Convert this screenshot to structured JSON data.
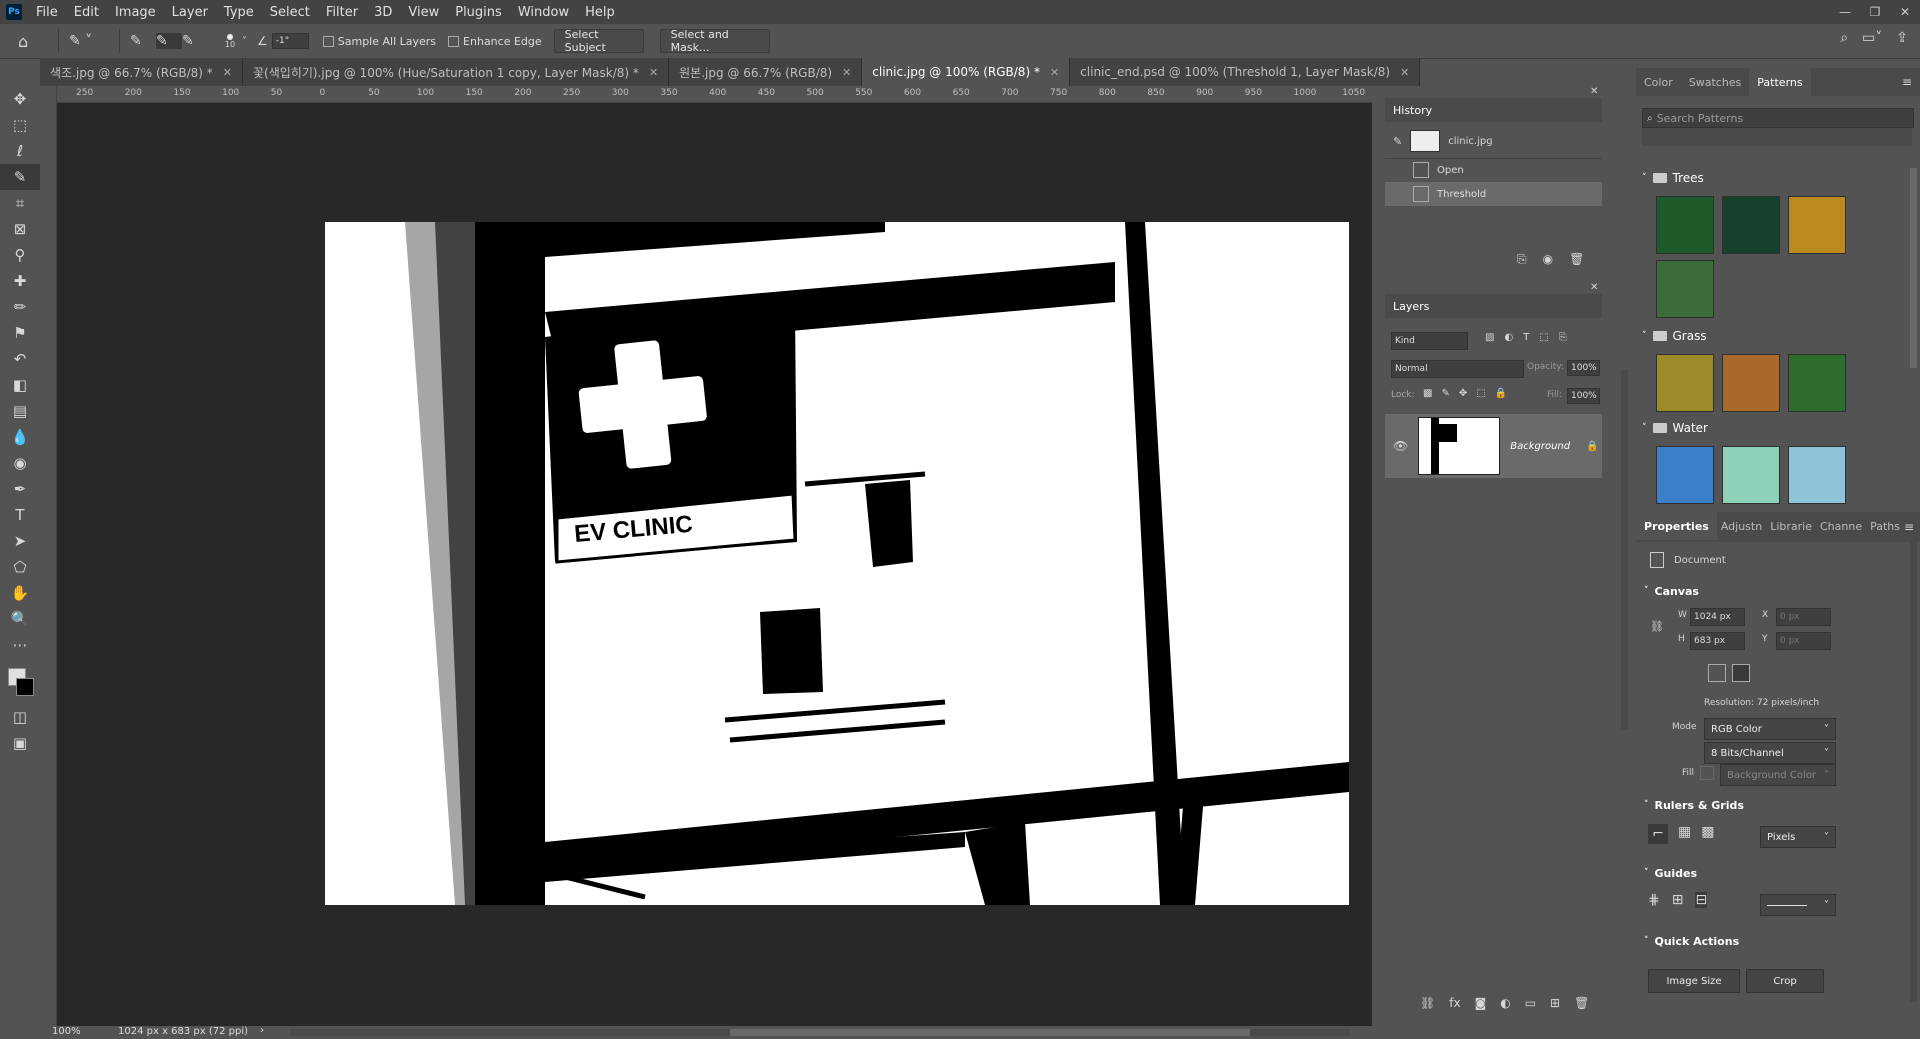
{
  "app": {
    "logo": "Ps"
  },
  "menu": [
    "File",
    "Edit",
    "Image",
    "Layer",
    "Type",
    "Select",
    "Filter",
    "3D",
    "View",
    "Plugins",
    "Window",
    "Help"
  ],
  "options": {
    "brush_size": "10",
    "angle": "-1°",
    "sample_all_layers": "Sample All Layers",
    "enhance_edge": "Enhance Edge",
    "select_subject": "Select Subject",
    "select_and_mask": "Select and Mask..."
  },
  "tabs": [
    {
      "label": "색조.jpg @ 66.7% (RGB/8) *",
      "active": false
    },
    {
      "label": "꽃(색입히기).jpg @ 100% (Hue/Saturation 1 copy, Layer Mask/8) *",
      "active": false
    },
    {
      "label": "원본.jpg @ 66.7% (RGB/8)",
      "active": false
    },
    {
      "label": "clinic.jpg @ 100% (RGB/8) *",
      "active": true
    },
    {
      "label": "clinic_end.psd @ 100% (Threshold 1, Layer Mask/8)",
      "active": false
    }
  ],
  "ruler_ticks": [
    "250",
    "200",
    "150",
    "100",
    "50",
    "0",
    "50",
    "100",
    "150",
    "200",
    "250",
    "300",
    "350",
    "400",
    "450",
    "500",
    "550",
    "600",
    "650",
    "700",
    "750",
    "800",
    "850",
    "900",
    "950",
    "1000",
    "1050"
  ],
  "canvas_text": "EV CLINIC",
  "status": {
    "zoom": "100%",
    "doc_info": "1024 px x 683 px (72 ppi)"
  },
  "history": {
    "title": "History",
    "snapshot": "clinic.jpg",
    "items": [
      "Open",
      "Threshold"
    ]
  },
  "layers": {
    "title": "Layers",
    "kind_placeholder": "Kind",
    "blend_mode": "Normal",
    "opacity_label": "Opacity:",
    "opacity_value": "100%",
    "lock_label": "Lock:",
    "fill_label": "Fill:",
    "fill_value": "100%",
    "layer_name": "Background"
  },
  "right_tabs": [
    "Color",
    "Swatches",
    "Patterns"
  ],
  "patterns": {
    "search_placeholder": "Search Patterns",
    "groups": [
      {
        "name": "Trees",
        "colors": [
          "#1f5a2a",
          "#17402e",
          "#b88a20",
          "#3e6b3a"
        ]
      },
      {
        "name": "Grass",
        "colors": [
          "#9c8b2a",
          "#a8692b",
          "#2e6b2c"
        ]
      },
      {
        "name": "Water",
        "colors": [
          "#3a7fc8",
          "#8fd1b8",
          "#8ec3d8"
        ]
      }
    ]
  },
  "properties": {
    "tabs": [
      "Properties",
      "Adjustn",
      "Librarie",
      "Channe",
      "Paths"
    ],
    "doc_label": "Document",
    "canvas_section": "Canvas",
    "w_label": "W",
    "w_value": "1024 px",
    "h_label": "H",
    "h_value": "683 px",
    "x_label": "X",
    "x_value": "0 px",
    "y_label": "Y",
    "y_value": "0 px",
    "resolution": "Resolution: 72 pixels/inch",
    "mode_label": "Mode",
    "mode_value": "RGB Color",
    "bits_value": "8 Bits/Channel",
    "fill_label": "Fill",
    "fill_value": "Background Color",
    "rulers_section": "Rulers & Grids",
    "units_value": "Pixels",
    "guides_section": "Guides",
    "quick_section": "Quick Actions",
    "image_size": "Image Size",
    "crop": "Crop"
  }
}
